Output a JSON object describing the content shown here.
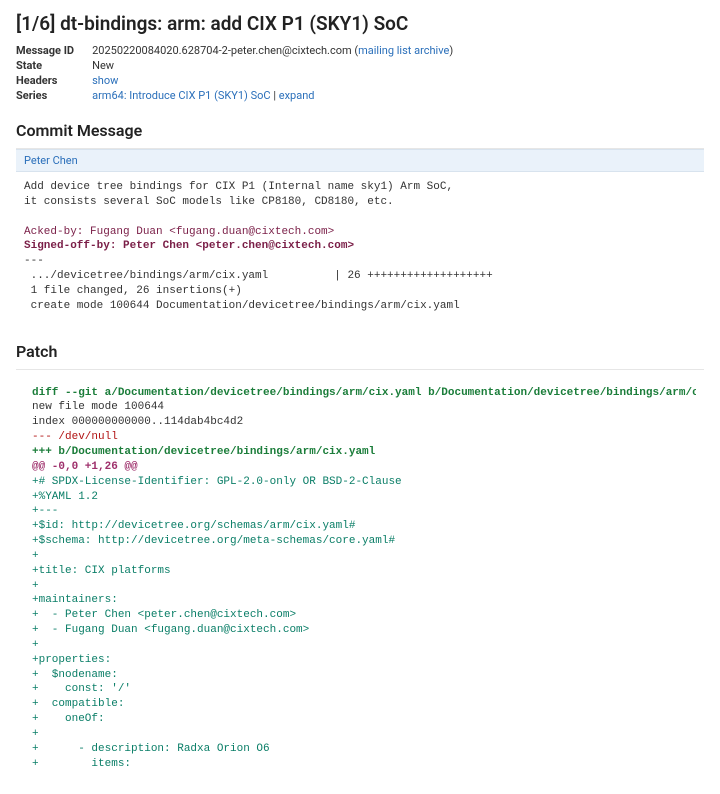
{
  "title": "[1/6] dt-bindings: arm: add CIX P1 (SKY1) SoC",
  "meta": {
    "messageId": {
      "label": "Message ID",
      "value": "20250220084020.628704-2-peter.chen@cixtech.com",
      "archive": "mailing list archive"
    },
    "state": {
      "label": "State",
      "value": "New"
    },
    "headers": {
      "label": "Headers",
      "link": "show"
    },
    "series": {
      "label": "Series",
      "link": "arm64: Introduce CIX P1 (SKY1) SoC",
      "expand": "expand"
    }
  },
  "commit": {
    "heading": "Commit Message",
    "author": "Peter Chen",
    "body1": "Add device tree bindings for CIX P1 (Internal name sky1) Arm SoC,\nit consists several SoC models like CP8180, CD8180, etc.\n",
    "ack": "Acked-by: Fugang Duan <fugang.duan@cixtech.com>",
    "sign": "Signed-off-by: Peter Chen <peter.chen@cixtech.com>",
    "body2": "---\n .../devicetree/bindings/arm/cix.yaml          | 26 +++++++++++++++++++\n 1 file changed, 26 insertions(+)\n create mode 100644 Documentation/devicetree/bindings/arm/cix.yaml"
  },
  "patch": {
    "heading": "Patch",
    "diffhdr": "diff --git a/Documentation/devicetree/bindings/arm/cix.yaml b/Documentation/devicetree/bindings/arm/cix.yaml",
    "meta1": "new file mode 100644",
    "meta2": "index 000000000000..114dab4bc4d2",
    "minus": "--- /dev/null",
    "plus": "+++ b/Documentation/devicetree/bindings/arm/cix.yaml",
    "hunk": "@@ -0,0 +1,26 @@",
    "body": "+# SPDX-License-Identifier: GPL-2.0-only OR BSD-2-Clause\n+%YAML 1.2\n+---\n+$id: http://devicetree.org/schemas/arm/cix.yaml#\n+$schema: http://devicetree.org/meta-schemas/core.yaml#\n+\n+title: CIX platforms\n+\n+maintainers:\n+  - Peter Chen <peter.chen@cixtech.com>\n+  - Fugang Duan <fugang.duan@cixtech.com>\n+\n+properties:\n+  $nodename:\n+    const: '/'\n+  compatible:\n+    oneOf:\n+\n+      - description: Radxa Orion O6\n+        items:"
  }
}
